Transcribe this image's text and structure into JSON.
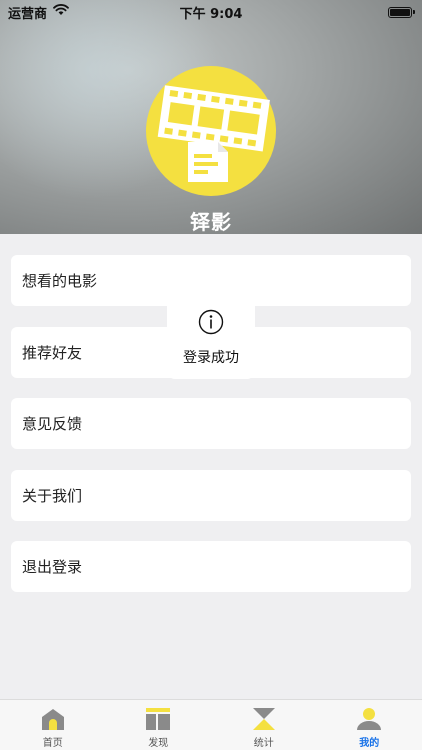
{
  "status_bar": {
    "carrier": "运营商",
    "time": "下午 9:04",
    "battery_level": 1.0
  },
  "profile": {
    "app_name": "铎影"
  },
  "menu": {
    "items": [
      {
        "label": "想看的电影"
      },
      {
        "label": "推荐好友"
      },
      {
        "label": "意见反馈"
      },
      {
        "label": "关于我们"
      },
      {
        "label": "退出登录"
      }
    ]
  },
  "toast": {
    "message": "登录成功",
    "icon": "info-icon"
  },
  "tabbar": {
    "tabs": [
      {
        "label": "首页",
        "icon": "home-icon"
      },
      {
        "label": "发现",
        "icon": "discover-icon"
      },
      {
        "label": "统计",
        "icon": "hourglass-icon"
      },
      {
        "label": "我的",
        "icon": "user-icon",
        "active": true
      }
    ]
  },
  "colors": {
    "accent": "#f4e040",
    "active_tab": "#1a73e8"
  }
}
